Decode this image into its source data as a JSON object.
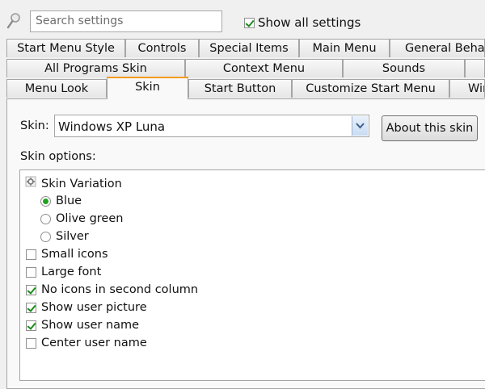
{
  "search": {
    "placeholder": "Search settings"
  },
  "show_all": {
    "label": "Show all settings",
    "checked": true
  },
  "tabs": {
    "row1": [
      "Start Menu Style",
      "Controls",
      "Special Items",
      "Main Menu",
      "General Behavior"
    ],
    "row2": [
      "All Programs Skin",
      "Context Menu",
      "Sounds",
      ""
    ],
    "row3": [
      "Menu Look",
      "Skin",
      "Start Button",
      "Customize Start Menu",
      "Windows"
    ],
    "active": "Skin"
  },
  "skin": {
    "label": "Skin:",
    "selected": "Windows XP Luna",
    "about_button": "About this skin",
    "options_label": "Skin options:"
  },
  "options": {
    "variation_label": "Skin Variation",
    "variations": [
      {
        "label": "Blue",
        "selected": true
      },
      {
        "label": "Olive green",
        "selected": false
      },
      {
        "label": "Silver",
        "selected": false
      }
    ],
    "checkboxes": [
      {
        "label": "Small icons",
        "checked": false
      },
      {
        "label": "Large font",
        "checked": false
      },
      {
        "label": "No icons in second column",
        "checked": true
      },
      {
        "label": "Show user picture",
        "checked": true
      },
      {
        "label": "Show user name",
        "checked": true
      },
      {
        "label": "Center user name",
        "checked": false
      }
    ]
  },
  "colors": {
    "active_tab_accent": "#f29c1f",
    "check_green": "#1a8a1a"
  }
}
